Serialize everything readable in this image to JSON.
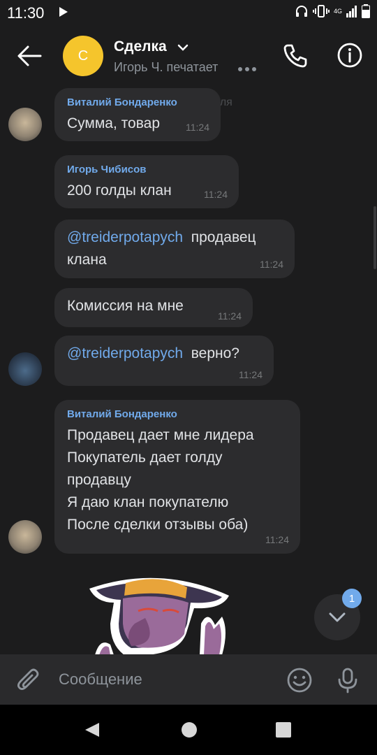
{
  "status_bar": {
    "time": "11:30",
    "network": "4G"
  },
  "header": {
    "avatar_letter": "С",
    "title": "Сделка",
    "status": "Игорь Ч. печатает"
  },
  "messages": [
    {
      "sender": "Виталий Бондаренко",
      "text": "Сумма, товар",
      "time": "11:24"
    },
    {
      "sender": "Игорь Чибисов",
      "text": "200 голды клан",
      "time": "11:24"
    },
    {
      "mention": "@treiderpotapych",
      "text": "продавец клана",
      "time": "11:24"
    },
    {
      "text": "Комиссия на мне",
      "time": "11:24"
    },
    {
      "mention": "@treiderpotapych",
      "text": "верно?",
      "time": "11:24"
    },
    {
      "sender": "Виталий Бондаренко",
      "lines": [
        "Продавец дает мне лидера",
        "Покупатель дает голду",
        "продавцу",
        "Я даю клан покупателю",
        "После сделки отзывы оба)"
      ],
      "time": "11:24"
    }
  ],
  "date_chip": "20 июля",
  "scroll_badge": "1",
  "composer": {
    "placeholder": "Сообщение"
  },
  "colors": {
    "accent": "#71aaeb",
    "bubble": "#2c2c2e",
    "background": "#1c1c1d",
    "avatar": "#f5c52c"
  },
  "icons": [
    "back-arrow-icon",
    "chevron-down-icon",
    "phone-icon",
    "info-icon",
    "chevron-down-icon",
    "paperclip-icon",
    "emoji-icon",
    "microphone-icon",
    "nav-back-icon",
    "nav-home-icon",
    "nav-recent-icon"
  ]
}
